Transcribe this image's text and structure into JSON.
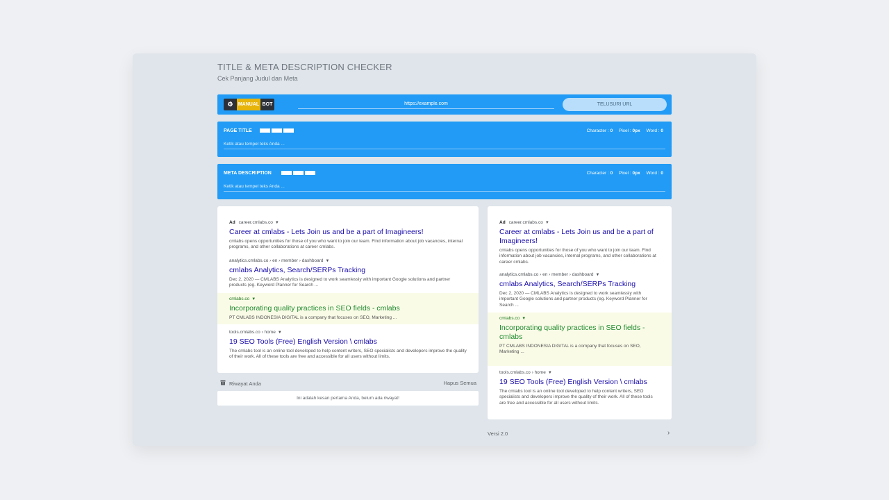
{
  "header": {
    "title": "TITLE & META DESCRIPTION CHECKER",
    "subtitle": "Cek Panjang Judul dan Meta"
  },
  "mode_toggle": {
    "settings_icon": "gear-icon",
    "manual_label": "MANUAL",
    "bot_label": "BOT",
    "active": "MANUAL"
  },
  "url_bar": {
    "placeholder": "https://example.com",
    "button_label": "TELUSURI URL"
  },
  "page_title_bar": {
    "label": "PAGE TITLE",
    "character_label": "Character :",
    "character_value": "0",
    "pixel_label": "Pixel :",
    "pixel_value": "0px",
    "word_label": "Word :",
    "word_value": "0",
    "placeholder": "Ketik atau tempel teks Anda ..."
  },
  "meta_description_bar": {
    "label": "META DESCRIPTION",
    "character_label": "Character :",
    "character_value": "0",
    "pixel_label": "Pixel :",
    "pixel_value": "0px",
    "word_label": "Word :",
    "word_value": "0",
    "placeholder": "Ketik atau tempel teks Anda ..."
  },
  "desktop_preview": {
    "results": [
      {
        "ad": "Ad",
        "url": "career.cmlabs.co",
        "title": "Career at cmlabs - Lets Join us and be a part of Imagineers!",
        "description": "cmlabs opens opportunities for those of you who want to join our team. Find information about job vacancies, internal programs, and other collaborations at career cmlabs."
      },
      {
        "url": "analytics.cmlabs.co › en › member › dashboard",
        "title": "cmlabs Analytics, Search/SERPs Tracking",
        "description": "Dec 2, 2020 — CMLABS Analytics is designed to work seamlessly with important Google solutions and partner products (eg. Keyword Planner for Search ..."
      },
      {
        "url": "cmlabs.co",
        "title": "Incorporating quality practices in SEO fields - cmlabs",
        "description": "PT CMLABS INDONESIA DIGITAL is a company that focuses on SEO, Marketing ..."
      },
      {
        "url": "tools.cmlabs.co › home",
        "title": "19 SEO Tools (Free) English Version \\ cmlabs",
        "description": "The cmlabs tool is an online tool developed to help content writers, SEO specialists and developers improve the quality of their work. All of these tools are free and accessible for all users without limits."
      }
    ]
  },
  "mobile_preview": {
    "results": [
      {
        "ad": "Ad",
        "url": "career.cmlabs.co",
        "title": "Career at cmlabs - Lets Join us and be a part of Imagineers!",
        "description": "cmlabs opens opportunities for those of you who want to join our team. Find information about job vacancies, internal programs, and other collaborations at career cmlabs."
      },
      {
        "url": "analytics.cmlabs.co › en › member › dashboard",
        "title": "cmlabs Analytics, Search/SERPs Tracking",
        "description": "Dec 2, 2020 — CMLABS Analytics is designed to work seamlessly with important Google solutions and partner products (eg. Keyword Planner for Search ..."
      },
      {
        "url": "cmlabs.co",
        "title": "Incorporating quality practices in SEO fields - cmlabs",
        "description": "PT CMLABS INDONESIA DIGITAL is a company that focuses on SEO, Marketing ..."
      },
      {
        "url": "tools.cmlabs.co › home",
        "title": "19 SEO Tools (Free) English Version \\ cmlabs",
        "description": "The cmlabs tool is an online tool developed to help content writers, SEO specialists and developers improve the quality of their work. All of these tools are free and accessible for all users without limits."
      }
    ]
  },
  "history": {
    "label": "Riwayat Anda",
    "icon": "archive-icon",
    "clear_label": "Hapus Semua",
    "empty_message": "Ini adalah kesan pertama Anda, belum ada riwayat!"
  },
  "footer": {
    "version": "Versi 2.0",
    "next_icon": "chevron-right-icon"
  },
  "colors": {
    "primary_blue": "#219bf5",
    "manual_yellow": "#e7b40a",
    "dark": "#2c3139",
    "link_blue": "#1a0dab",
    "highlight_green": "#1f8a2e"
  }
}
